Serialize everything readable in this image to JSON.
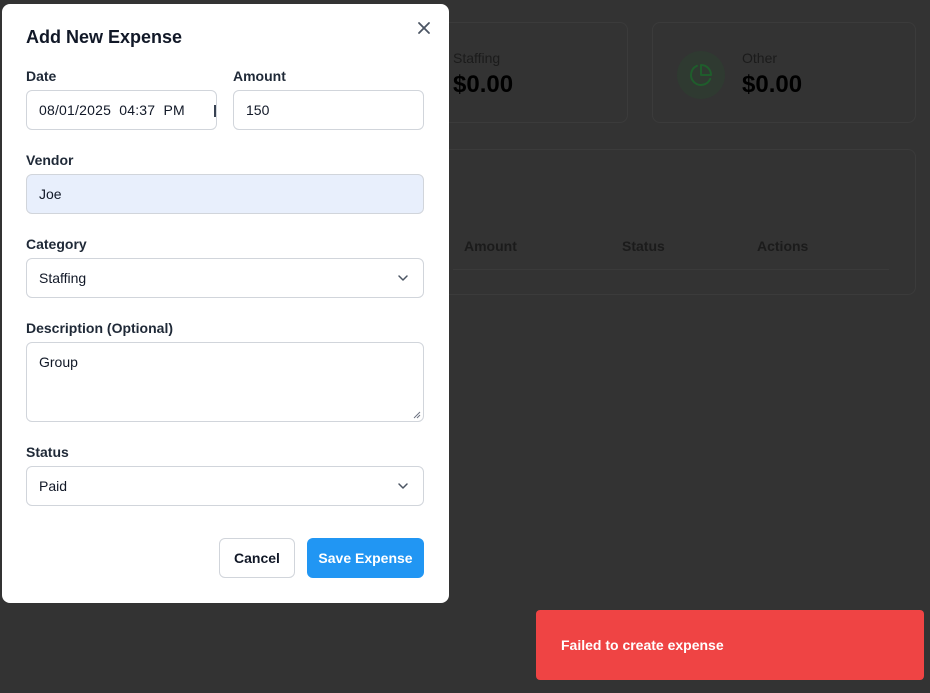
{
  "background": {
    "summary_cards": [
      {
        "label": "Staffing",
        "value": "$0.00"
      },
      {
        "label": "Other",
        "value": "$0.00",
        "icon": "pie-chart-icon"
      }
    ],
    "table": {
      "headers": [
        "Amount",
        "Status",
        "Actions"
      ]
    }
  },
  "modal": {
    "title": "Add New Expense",
    "close_icon": "close-icon",
    "fields": {
      "date": {
        "label": "Date",
        "value": "08/01/2025  04:37  PM"
      },
      "amount": {
        "label": "Amount",
        "value": "150"
      },
      "vendor": {
        "label": "Vendor",
        "value": "Joe"
      },
      "category": {
        "label": "Category",
        "value": "Staffing"
      },
      "description": {
        "label": "Description (Optional)",
        "value": "Group"
      },
      "status": {
        "label": "Status",
        "value": "Paid"
      }
    },
    "buttons": {
      "cancel": "Cancel",
      "save": "Save Expense"
    }
  },
  "toast": {
    "message": "Failed to create expense"
  },
  "colors": {
    "primary": "#2196f3",
    "error": "#ef4444",
    "overlay": "#333333",
    "autofill": "#e8effc"
  }
}
